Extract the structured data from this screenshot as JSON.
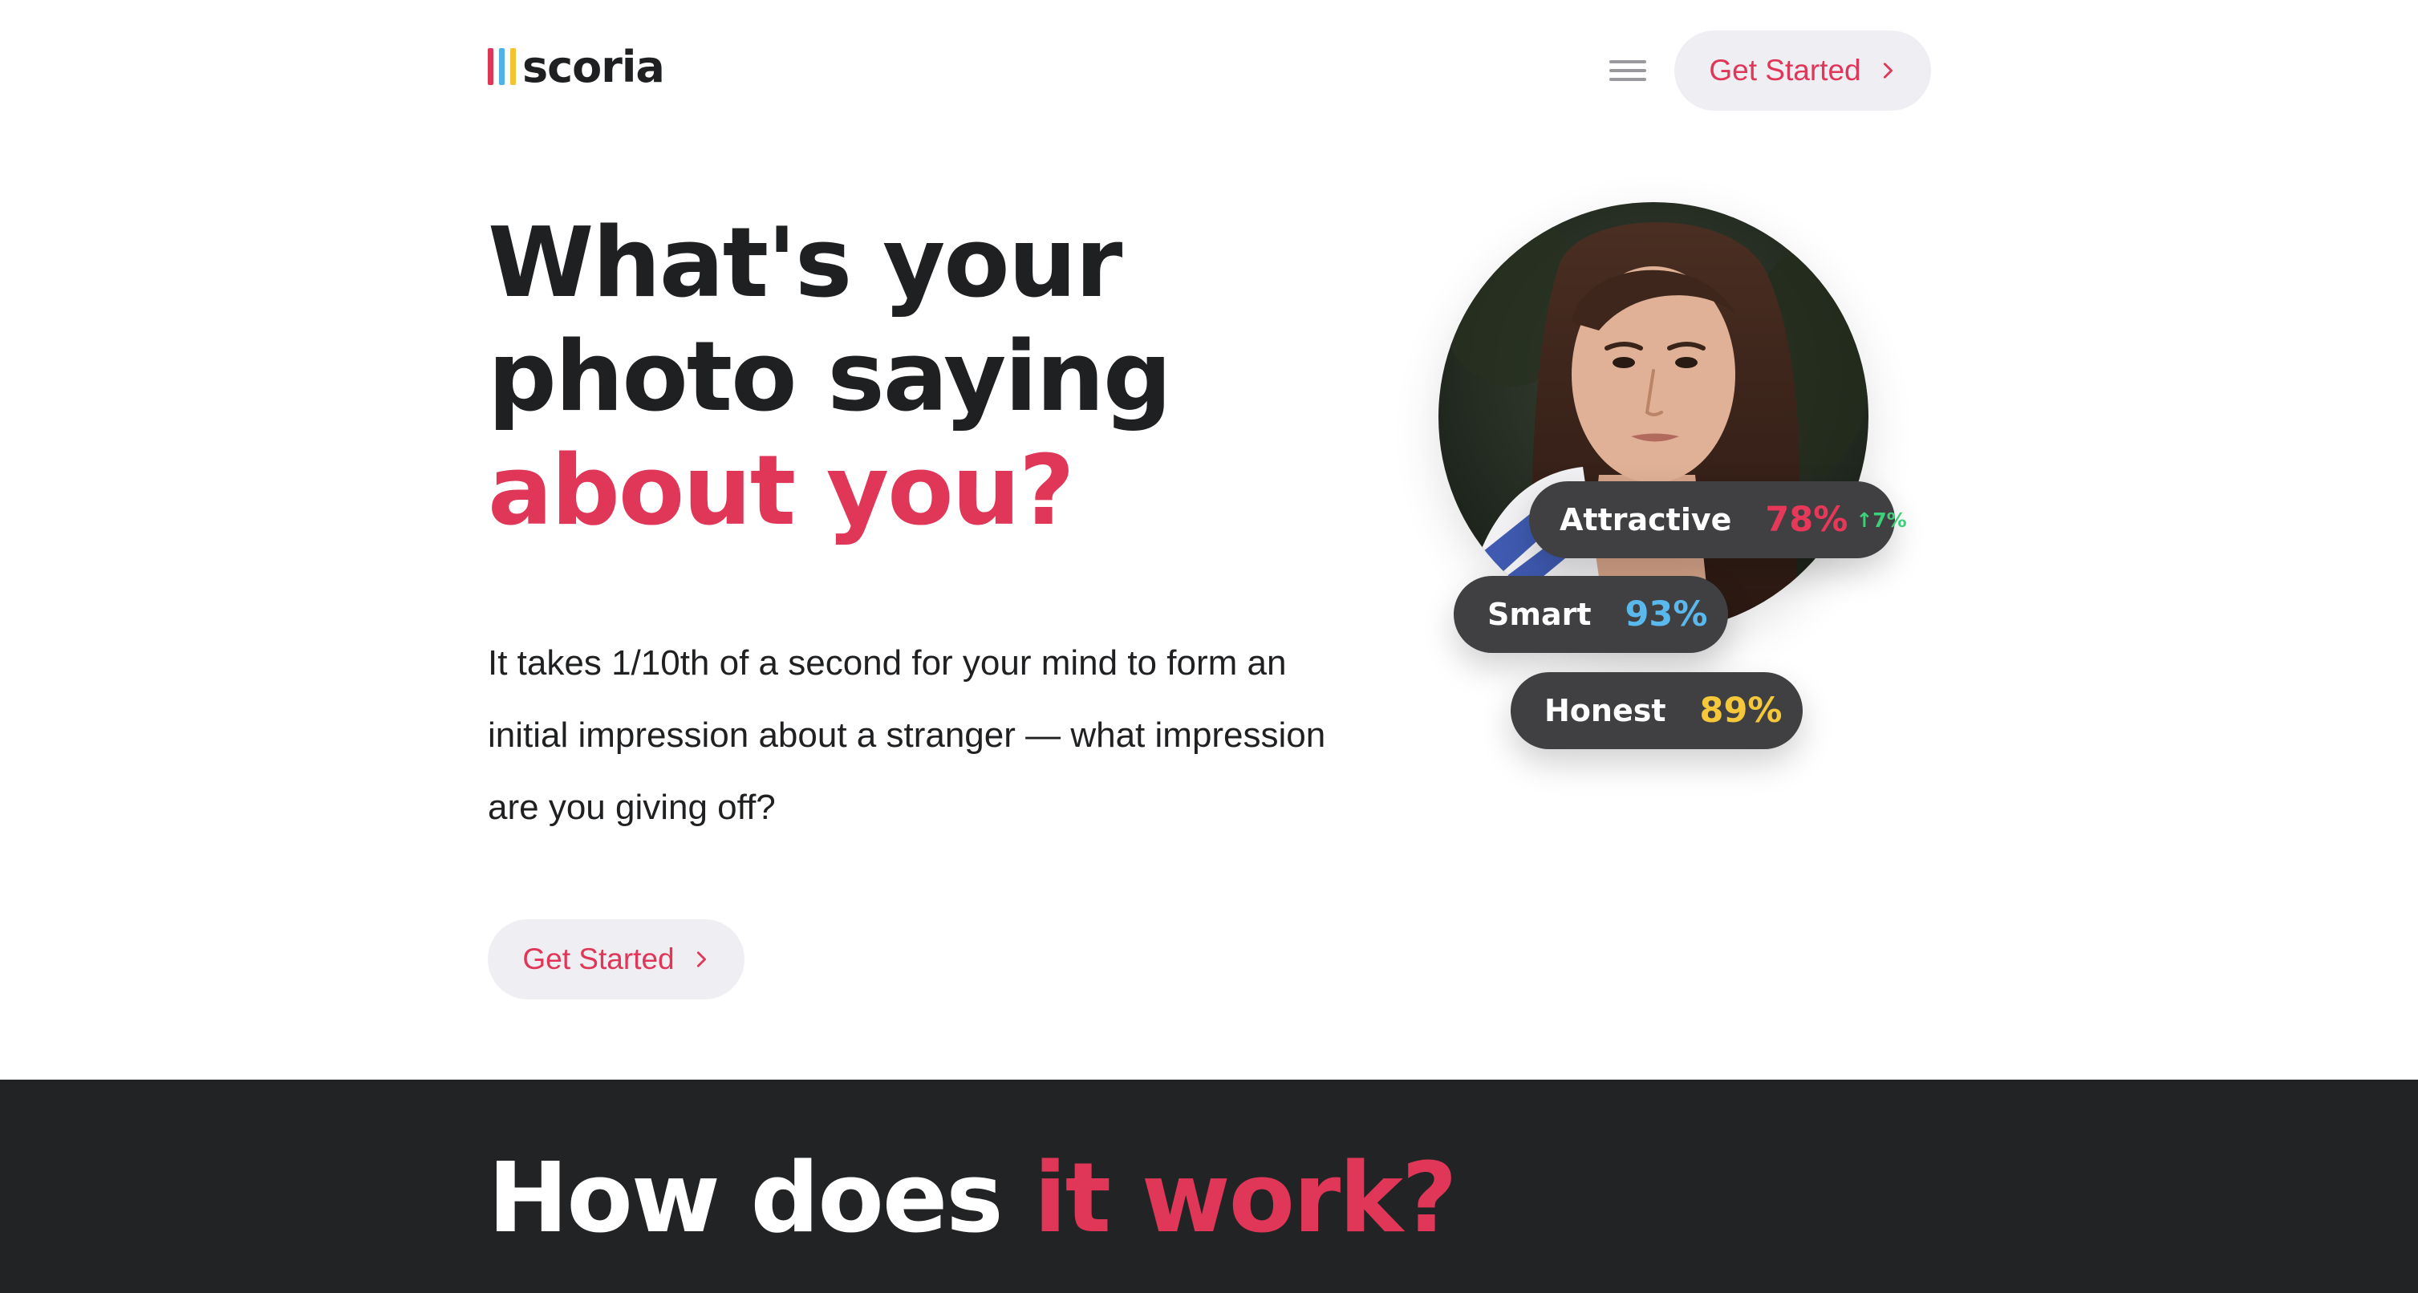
{
  "brand": {
    "name": "scoria",
    "bar_colors": [
      "#e03657",
      "#4fb3e6",
      "#f4c430"
    ]
  },
  "header": {
    "menu_icon": "hamburger-menu-icon",
    "cta_label": "Get Started",
    "cta_icon": "chevron-right-icon"
  },
  "hero": {
    "headline_line1": "What's your",
    "headline_line2": "photo saying",
    "headline_accent": "about you?",
    "lede": "It takes 1/10th of a second for your mind to form an initial impression about a stranger — what impression are you giving off?",
    "cta_label": "Get Started",
    "cta_icon": "chevron-right-icon"
  },
  "scores": [
    {
      "label": "Attractive",
      "value": "78%",
      "delta": "↑7%",
      "color": "#e8385a",
      "delta_color": "#3ecf7a"
    },
    {
      "label": "Smart",
      "value": "93%",
      "color": "#5ab8ec"
    },
    {
      "label": "Honest",
      "value": "89%",
      "color": "#f5c73b"
    }
  ],
  "how_section": {
    "title_plain": "How does ",
    "title_accent": "it work?"
  },
  "colors": {
    "accent": "#e03657",
    "dark": "#1f2022",
    "pill_bg": "#efeef3",
    "score_pill_bg": "#404042"
  }
}
